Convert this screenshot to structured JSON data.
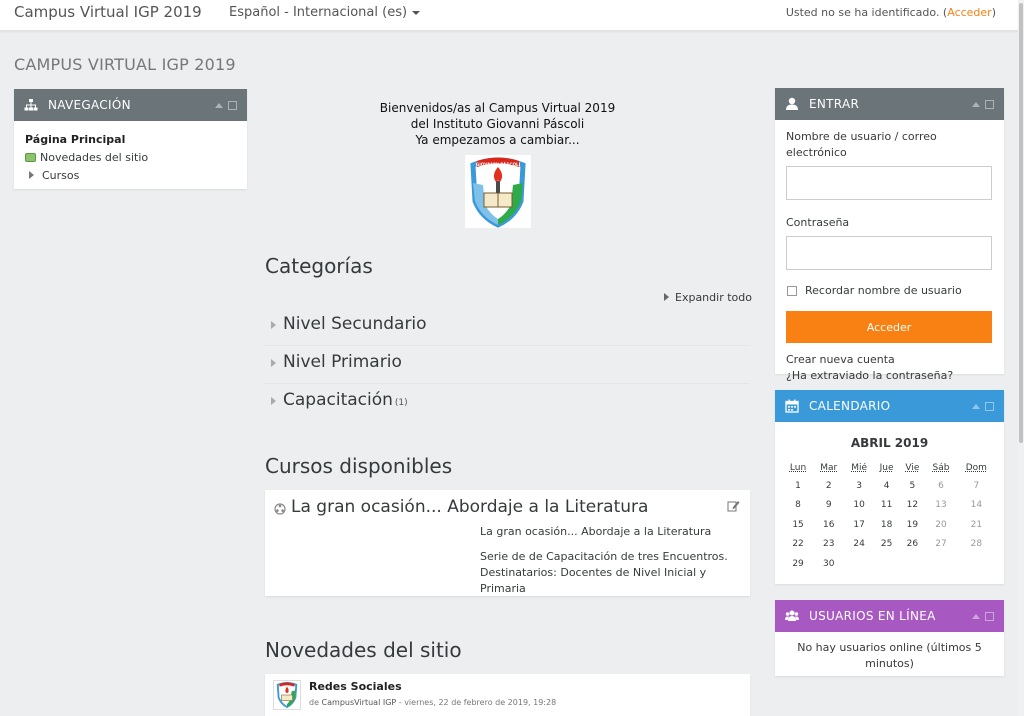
{
  "navbar": {
    "brand": "Campus Virtual IGP 2019",
    "language": "Español - Internacional (es)",
    "login_status": "Usted no se ha identificado. (",
    "login_link": "Acceder",
    "login_close": ")"
  },
  "page": {
    "heading": "CAMPUS VIRTUAL IGP 2019"
  },
  "navigation_block": {
    "title": "NAVEGACIÓN",
    "home": "Página Principal",
    "site_news": "Novedades del sitio",
    "courses": "Cursos"
  },
  "welcome": {
    "line1": "Bienvenidos/as al Campus Virtual 2019",
    "line2": "del Instituto Giovanni Páscoli",
    "line3": "Ya empezamos a cambiar...",
    "logo_text": "GIOVANNI PÁSCOLI"
  },
  "categories": {
    "heading": "Categorías",
    "expand_all": "Expandir todo",
    "items": [
      {
        "name": "Nivel Secundario",
        "count": ""
      },
      {
        "name": "Nivel Primario",
        "count": ""
      },
      {
        "name": "Capacitación",
        "count": "(1)"
      }
    ]
  },
  "courses": {
    "heading": "Cursos disponibles",
    "title": "La gran ocasión... Abordaje a la Literatura",
    "summary_title": "La gran ocasión... Abordaje a la Literatura",
    "summary_line1": "Serie de de Capacitación de tres Encuentros.",
    "summary_line2": "Destinatarios: Docentes de Nivel Inicial y Primaria"
  },
  "news": {
    "heading": "Novedades del sitio",
    "post_title": "Redes Sociales",
    "post_by": "de",
    "post_author": "CampusVirtual IGP",
    "post_date": " - viernes, 22 de febrero de 2019, 19:28"
  },
  "login_block": {
    "title": "ENTRAR",
    "username_label": "Nombre de usuario / correo electrónico",
    "password_label": "Contraseña",
    "remember_label": "Recordar nombre de usuario",
    "submit": "Acceder",
    "create_account": "Crear nueva cuenta",
    "forgot_password": "¿Ha extraviado la contraseña?"
  },
  "calendar_block": {
    "title": "CALENDARIO",
    "month": "ABRIL 2019",
    "weekdays": [
      "Lun",
      "Mar",
      "Mié",
      "Jue",
      "Vie",
      "Sáb",
      "Dom"
    ],
    "weeks": [
      [
        "1",
        "2",
        "3",
        "4",
        "5",
        "6",
        "7"
      ],
      [
        "8",
        "9",
        "10",
        "11",
        "12",
        "13",
        "14"
      ],
      [
        "15",
        "16",
        "17",
        "18",
        "19",
        "20",
        "21"
      ],
      [
        "22",
        "23",
        "24",
        "25",
        "26",
        "27",
        "28"
      ],
      [
        "29",
        "30",
        "",
        "",
        "",
        "",
        ""
      ]
    ]
  },
  "online_block": {
    "title": "USUARIOS EN LÍNEA",
    "message": "No hay usuarios online (últimos 5 minutos)"
  },
  "colors": {
    "accent": "#f98012",
    "nav_header": "#6b7478",
    "calendar_header": "#3a9ad9",
    "online_header": "#a759c1"
  }
}
